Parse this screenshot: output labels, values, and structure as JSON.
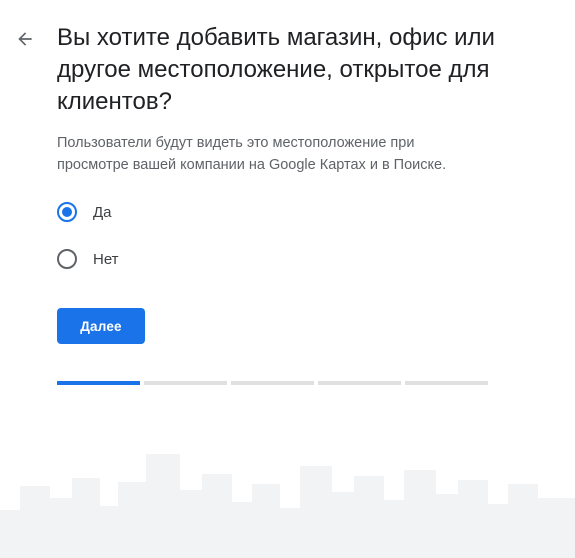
{
  "header": {
    "back_icon": "arrow-left-icon"
  },
  "question": {
    "title": "Вы хотите добавить магазин, офис или другое местоположение, открытое для клиентов?",
    "description": "Пользователи будут видеть это местоположение при просмотре вашей компании на Google Картах и в Поиске."
  },
  "options": [
    {
      "label": "Да",
      "selected": true
    },
    {
      "label": "Нет",
      "selected": false
    }
  ],
  "actions": {
    "next_label": "Далее"
  },
  "progress": {
    "total_steps": 5,
    "current_step": 1
  },
  "colors": {
    "accent": "#1a73e8",
    "title": "#202124",
    "description": "#5f6368",
    "progress_inactive": "#e0e0e0",
    "skyline": "#f1f3f4"
  }
}
